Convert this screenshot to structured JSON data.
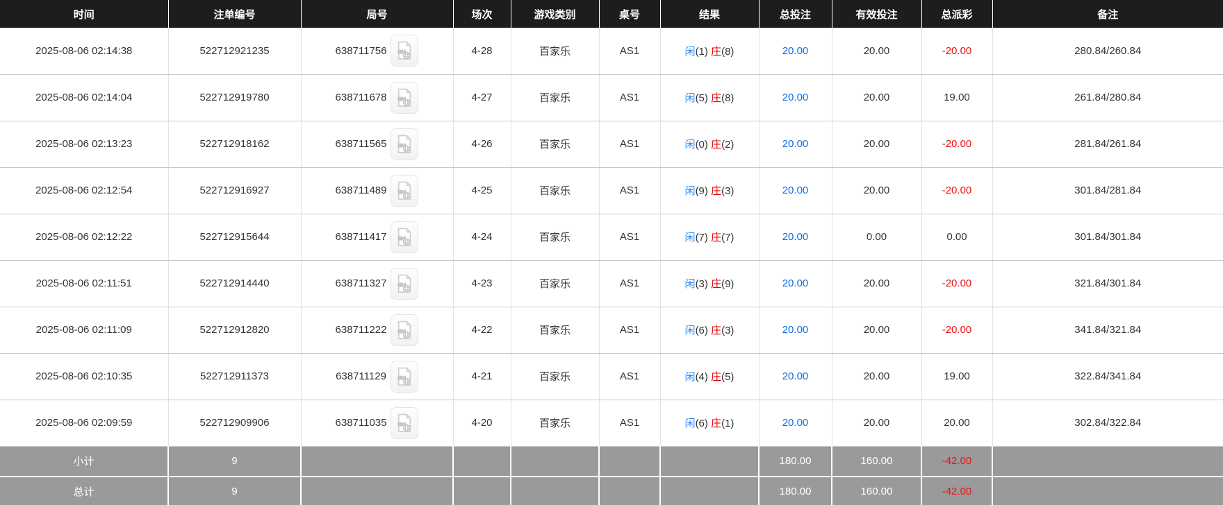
{
  "colors": {
    "header_bg": "#1d1d1d",
    "header_text": "#ffffff",
    "row_text": "#333333",
    "link_blue": "#0d6ee0",
    "player_blue": "#2a8af0",
    "banker_red": "#e60000",
    "negative_red": "#ee1111",
    "summary_bg": "#9a9a9a",
    "summary_text": "#ffffff"
  },
  "icons": {
    "video_replay": "video-file-icon"
  },
  "table": {
    "columns": [
      {
        "key": "time",
        "label": "时间"
      },
      {
        "key": "order_no",
        "label": "注单编号"
      },
      {
        "key": "round_no",
        "label": "局号"
      },
      {
        "key": "session",
        "label": "场次"
      },
      {
        "key": "game_type",
        "label": "游戏类别"
      },
      {
        "key": "table_no",
        "label": "桌号"
      },
      {
        "key": "result",
        "label": "结果"
      },
      {
        "key": "total_bet",
        "label": "总投注"
      },
      {
        "key": "valid_bet",
        "label": "有效投注"
      },
      {
        "key": "total_payout",
        "label": "总派彩"
      },
      {
        "key": "remark",
        "label": "备注"
      }
    ],
    "rows": [
      {
        "time": "2025-08-06 02:14:38",
        "order_no": "522712921235",
        "round_no": "638711756",
        "session": "4-28",
        "game_type": "百家乐",
        "table_no": "AS1",
        "result_player": "闲",
        "result_player_pts": "(1)",
        "result_banker": "庄",
        "result_banker_pts": "(8)",
        "total_bet": "20.00",
        "valid_bet": "20.00",
        "payout": "-20.00",
        "remark": "280.84/260.84"
      },
      {
        "time": "2025-08-06 02:14:04",
        "order_no": "522712919780",
        "round_no": "638711678",
        "session": "4-27",
        "game_type": "百家乐",
        "table_no": "AS1",
        "result_player": "闲",
        "result_player_pts": "(5)",
        "result_banker": "庄",
        "result_banker_pts": "(8)",
        "total_bet": "20.00",
        "valid_bet": "20.00",
        "payout": "19.00",
        "remark": "261.84/280.84"
      },
      {
        "time": "2025-08-06 02:13:23",
        "order_no": "522712918162",
        "round_no": "638711565",
        "session": "4-26",
        "game_type": "百家乐",
        "table_no": "AS1",
        "result_player": "闲",
        "result_player_pts": "(0)",
        "result_banker": "庄",
        "result_banker_pts": "(2)",
        "total_bet": "20.00",
        "valid_bet": "20.00",
        "payout": "-20.00",
        "remark": "281.84/261.84"
      },
      {
        "time": "2025-08-06 02:12:54",
        "order_no": "522712916927",
        "round_no": "638711489",
        "session": "4-25",
        "game_type": "百家乐",
        "table_no": "AS1",
        "result_player": "闲",
        "result_player_pts": "(9)",
        "result_banker": "庄",
        "result_banker_pts": "(3)",
        "total_bet": "20.00",
        "valid_bet": "20.00",
        "payout": "-20.00",
        "remark": "301.84/281.84"
      },
      {
        "time": "2025-08-06 02:12:22",
        "order_no": "522712915644",
        "round_no": "638711417",
        "session": "4-24",
        "game_type": "百家乐",
        "table_no": "AS1",
        "result_player": "闲",
        "result_player_pts": "(7)",
        "result_banker": "庄",
        "result_banker_pts": "(7)",
        "total_bet": "20.00",
        "valid_bet": "0.00",
        "payout": "0.00",
        "remark": "301.84/301.84"
      },
      {
        "time": "2025-08-06 02:11:51",
        "order_no": "522712914440",
        "round_no": "638711327",
        "session": "4-23",
        "game_type": "百家乐",
        "table_no": "AS1",
        "result_player": "闲",
        "result_player_pts": "(3)",
        "result_banker": "庄",
        "result_banker_pts": "(9)",
        "total_bet": "20.00",
        "valid_bet": "20.00",
        "payout": "-20.00",
        "remark": "321.84/301.84"
      },
      {
        "time": "2025-08-06 02:11:09",
        "order_no": "522712912820",
        "round_no": "638711222",
        "session": "4-22",
        "game_type": "百家乐",
        "table_no": "AS1",
        "result_player": "闲",
        "result_player_pts": "(6)",
        "result_banker": "庄",
        "result_banker_pts": "(3)",
        "total_bet": "20.00",
        "valid_bet": "20.00",
        "payout": "-20.00",
        "remark": "341.84/321.84"
      },
      {
        "time": "2025-08-06 02:10:35",
        "order_no": "522712911373",
        "round_no": "638711129",
        "session": "4-21",
        "game_type": "百家乐",
        "table_no": "AS1",
        "result_player": "闲",
        "result_player_pts": "(4)",
        "result_banker": "庄",
        "result_banker_pts": "(5)",
        "total_bet": "20.00",
        "valid_bet": "20.00",
        "payout": "19.00",
        "remark": "322.84/341.84"
      },
      {
        "time": "2025-08-06 02:09:59",
        "order_no": "522712909906",
        "round_no": "638711035",
        "session": "4-20",
        "game_type": "百家乐",
        "table_no": "AS1",
        "result_player": "闲",
        "result_player_pts": "(6)",
        "result_banker": "庄",
        "result_banker_pts": "(1)",
        "total_bet": "20.00",
        "valid_bet": "20.00",
        "payout": "20.00",
        "remark": "302.84/322.84"
      }
    ],
    "subtotal": {
      "label": "小计",
      "count": "9",
      "total_bet": "180.00",
      "valid_bet": "160.00",
      "payout": "-42.00",
      "remark": ""
    },
    "total": {
      "label": "总计",
      "count": "9",
      "total_bet": "180.00",
      "valid_bet": "160.00",
      "payout": "-42.00",
      "remark": ""
    }
  }
}
